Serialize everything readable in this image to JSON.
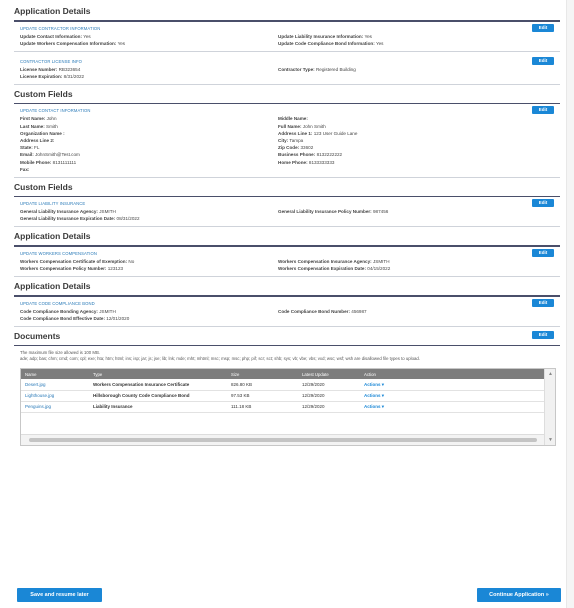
{
  "sections": {
    "app_details_1": "Application Details",
    "custom_fields_1": "Custom Fields",
    "custom_fields_2": "Custom Fields",
    "app_details_2": "Application Details",
    "app_details_3": "Application Details",
    "documents": "Documents"
  },
  "edit_label": "Edit",
  "update_contractor": {
    "title": "UPDATE CONTRACTOR INFORMATION",
    "left": [
      {
        "label": "Update Contact Information:",
        "value": "Yes"
      },
      {
        "label": "Update Workers Compensation Information:",
        "value": "Yes"
      }
    ],
    "right": [
      {
        "label": "Update Liability Insurance Information:",
        "value": "Yes"
      },
      {
        "label": "Update Code Compliance Bond Information:",
        "value": "Yes"
      }
    ]
  },
  "license": {
    "title": "CONTRACTOR LICENSE INFO",
    "left": [
      {
        "label": "License Number:",
        "value": "RB323654"
      },
      {
        "label": "License Expiration:",
        "value": "8/31/2022"
      }
    ],
    "right": [
      {
        "label": "Contractor Type:",
        "value": "Registered Building"
      }
    ]
  },
  "contact": {
    "title": "UPDATE CONTACT INFORMATION",
    "left": [
      {
        "label": "First Name:",
        "value": "John"
      },
      {
        "label": "Last Name:",
        "value": "Smith"
      },
      {
        "label": "Organization Name :",
        "value": ""
      },
      {
        "label": "Address Line 2:",
        "value": ""
      },
      {
        "label": "State:",
        "value": "FL"
      },
      {
        "label": "Email:",
        "value": "JohnSmith@Test.com"
      },
      {
        "label": "Mobile Phone:",
        "value": "8131111111"
      },
      {
        "label": "Fax:",
        "value": ""
      }
    ],
    "right": [
      {
        "label": "Middle Name:",
        "value": ""
      },
      {
        "label": "Full Name:",
        "value": "John Smith"
      },
      {
        "label": "Address Line 1:",
        "value": "123 User Guide Lane"
      },
      {
        "label": "City:",
        "value": "Tampa"
      },
      {
        "label": "Zip Code:",
        "value": "33602"
      },
      {
        "label": "Business Phone:",
        "value": "8132222222"
      },
      {
        "label": "Home Phone:",
        "value": "8133333333"
      }
    ]
  },
  "liability": {
    "title": "UPDATE LIABILITY INSURANCE",
    "left": [
      {
        "label": "General Liability Insurance Agency:",
        "value": "JSMITH"
      },
      {
        "label": "General Liability Insurance Expiration Date:",
        "value": "08/31/2022"
      }
    ],
    "right": [
      {
        "label": "General Liability Insurance Policy Number:",
        "value": "987456"
      }
    ]
  },
  "workers": {
    "title": "UPDATE WORKERS COMPENSATION",
    "left": [
      {
        "label": "Workers Compensation Certificate of Exemption:",
        "value": "No"
      },
      {
        "label": "Workers Compensation Policy Number:",
        "value": "123123"
      }
    ],
    "right": [
      {
        "label": "Workers Compensation Insurance Agency:",
        "value": "JSMITH"
      },
      {
        "label": "Workers Compensation Expiration Date:",
        "value": "04/15/2022"
      }
    ]
  },
  "bond": {
    "title": "UPDATE CODE COMPLIANCE BOND",
    "left": [
      {
        "label": "Code Compliance Bonding Agency:",
        "value": "JSMITH"
      },
      {
        "label": "Code Compliance Bond Effective Date:",
        "value": "12/01/2020"
      }
    ],
    "right": [
      {
        "label": "Code Compliance Bond Number:",
        "value": "456987"
      }
    ]
  },
  "documents": {
    "note_1": "The maximum file size allowed is 100 MB.",
    "note_2": "ade; adp; bas; chm; cmd; com; cpl; exe; hta; htm; html; ins; isp; jar; js; jse; lib; lnk; mde; mht; mhtml; msc; msp; msc; php; pif; scr; sct; shb; sys; vb; vbe; vbs; vxd; wsc; wsf; wsh are disallowed file types to upload.",
    "columns": [
      "Name",
      "Type",
      "Size",
      "Latest Update",
      "Action"
    ],
    "rows": [
      {
        "name": "Desert.jpg",
        "type": "Workers Compensation Insurance Certificate",
        "size": "826.80 KB",
        "date": "12/29/2020",
        "action": "Actions ▾"
      },
      {
        "name": "Lighthouse.jpg",
        "type": "Hillsborough County Code Compliance Bond",
        "size": "97.53 KB",
        "date": "12/29/2020",
        "action": "Actions ▾"
      },
      {
        "name": "Penguins.jpg",
        "type": "Liability Insurance",
        "size": "111.18 KB",
        "date": "12/29/2020",
        "action": "Actions ▾"
      }
    ]
  },
  "buttons": {
    "save": "Save and resume later",
    "continue": "Continue Application »"
  },
  "colors": {
    "accent": "#1a87d6",
    "link": "#2a7ab8",
    "rule": "#4a4f6a",
    "table_header": "#7d7d7d"
  }
}
